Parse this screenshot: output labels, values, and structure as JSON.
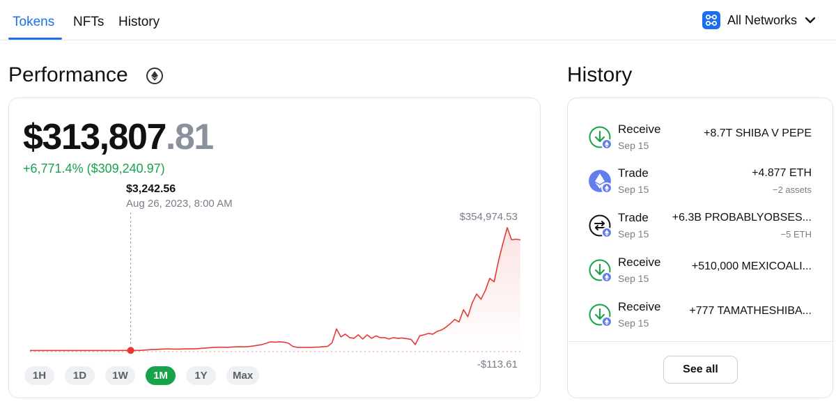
{
  "tabs": [
    {
      "label": "Tokens",
      "active": true
    },
    {
      "label": "NFTs",
      "active": false
    },
    {
      "label": "History",
      "active": false
    }
  ],
  "network": {
    "label": "All Networks",
    "icon": "network-grid-icon"
  },
  "performance": {
    "title": "Performance",
    "balance_main": "$313,807",
    "balance_cents": ".81",
    "change": "+6,771.4% ($309,240.97)",
    "tooltip_value": "$3,242.56",
    "tooltip_date": "Aug 26, 2023, 8:00 AM",
    "max_label": "$354,974.53",
    "min_label": "-$113.61",
    "ranges": [
      {
        "label": "1H",
        "active": false
      },
      {
        "label": "1D",
        "active": false
      },
      {
        "label": "1W",
        "active": false
      },
      {
        "label": "1M",
        "active": true
      },
      {
        "label": "1Y",
        "active": false
      },
      {
        "label": "Max",
        "active": false
      }
    ]
  },
  "chart_data": {
    "type": "line",
    "title": "",
    "xlabel": "",
    "ylabel": "",
    "ylim": [
      -113.61,
      354974.53
    ],
    "grid": false,
    "line_color": "#e53935",
    "marker_index": 23,
    "values": [
      3100,
      3100,
      3100,
      3100,
      3100,
      3050,
      3150,
      3150,
      3150,
      3150,
      3100,
      3100,
      3100,
      3100,
      3100,
      3150,
      3150,
      3150,
      3150,
      3150,
      3150,
      3200,
      3250,
      3242.56,
      3300,
      3200,
      4000,
      5000,
      6000,
      6000,
      7000,
      7500,
      7500,
      7000,
      7000,
      7500,
      7500,
      8000,
      8000,
      9000,
      10000,
      11000,
      12000,
      12500,
      12500,
      12000,
      13000,
      13500,
      14000,
      13500,
      14500,
      16000,
      18000,
      20000,
      24000,
      28000,
      27000,
      28000,
      27000,
      24000,
      15000,
      12000,
      12000,
      12000,
      12000,
      12500,
      13000,
      14000,
      15000,
      25000,
      65000,
      42000,
      50000,
      40000,
      38000,
      48000,
      36000,
      48000,
      38000,
      45000,
      40000,
      40000,
      36000,
      40000,
      38000,
      39000,
      37000,
      35000,
      20000,
      45000,
      48000,
      52000,
      50000,
      58000,
      62000,
      70000,
      80000,
      92000,
      85000,
      120000,
      100000,
      140000,
      165000,
      150000,
      175000,
      210000,
      200000,
      260000,
      310000,
      354974.53,
      320000,
      322000,
      320000
    ]
  },
  "history": {
    "title": "History",
    "items": [
      {
        "type": "Receive",
        "date": "Sep 15",
        "amount": "+8.7T SHIBA V PEPE",
        "sub": "",
        "icon": "receive-arrow-icon"
      },
      {
        "type": "Trade",
        "date": "Sep 15",
        "amount": "+4.877 ETH",
        "sub": "−2 assets",
        "icon": "ethereum-icon"
      },
      {
        "type": "Trade",
        "date": "Sep 15",
        "amount": "+6.3B PROBABLYOBSES...",
        "sub": "−5 ETH",
        "icon": "swap-icon"
      },
      {
        "type": "Receive",
        "date": "Sep 15",
        "amount": "+510,000 MEXICOALI...",
        "sub": "",
        "icon": "receive-arrow-icon"
      },
      {
        "type": "Receive",
        "date": "Sep 15",
        "amount": "+777 TAMATHESHIBA...",
        "sub": "",
        "icon": "receive-arrow-icon"
      }
    ],
    "see_all": "See all"
  }
}
